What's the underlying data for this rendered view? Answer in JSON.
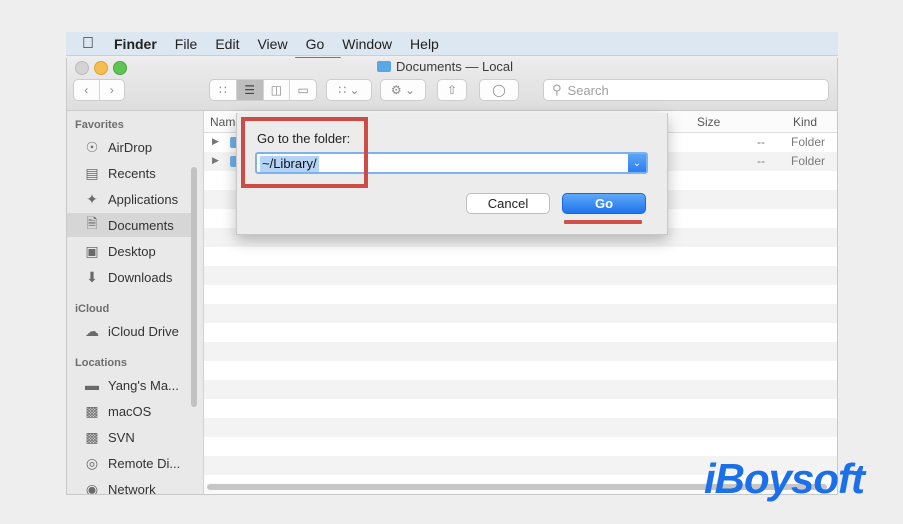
{
  "menubar": {
    "apple_icon": "apple-icon",
    "items": [
      "Finder",
      "File",
      "Edit",
      "View",
      "Go",
      "Window",
      "Help"
    ]
  },
  "window": {
    "title": "Documents — Local",
    "search_placeholder": "Search"
  },
  "sidebar": {
    "sections": [
      {
        "header": "Favorites",
        "items": [
          {
            "label": "AirDrop",
            "icon": "airdrop-icon"
          },
          {
            "label": "Recents",
            "icon": "clock-icon"
          },
          {
            "label": "Applications",
            "icon": "applications-icon"
          },
          {
            "label": "Documents",
            "icon": "document-icon",
            "selected": true
          },
          {
            "label": "Desktop",
            "icon": "desktop-icon"
          },
          {
            "label": "Downloads",
            "icon": "download-icon"
          }
        ]
      },
      {
        "header": "iCloud",
        "items": [
          {
            "label": "iCloud Drive",
            "icon": "cloud-icon"
          }
        ]
      },
      {
        "header": "Locations",
        "items": [
          {
            "label": "Yang's Ma...",
            "icon": "laptop-icon"
          },
          {
            "label": "macOS",
            "icon": "disk-icon"
          },
          {
            "label": "SVN",
            "icon": "disk-icon"
          },
          {
            "label": "Remote Di...",
            "icon": "remote-disk-icon"
          },
          {
            "label": "Network",
            "icon": "network-icon"
          }
        ]
      }
    ]
  },
  "columns": {
    "name": "Name",
    "size": "Size",
    "kind": "Kind"
  },
  "rows": [
    {
      "size": "--",
      "kind": "Folder"
    },
    {
      "size": "--",
      "kind": "Folder"
    }
  ],
  "dialog": {
    "label": "Go to the folder:",
    "input_value": "~/Library/",
    "cancel": "Cancel",
    "go": "Go"
  },
  "brand": "iBoysoft",
  "colors": {
    "highlight": "#d0504a",
    "accent": "#1f74ec"
  }
}
